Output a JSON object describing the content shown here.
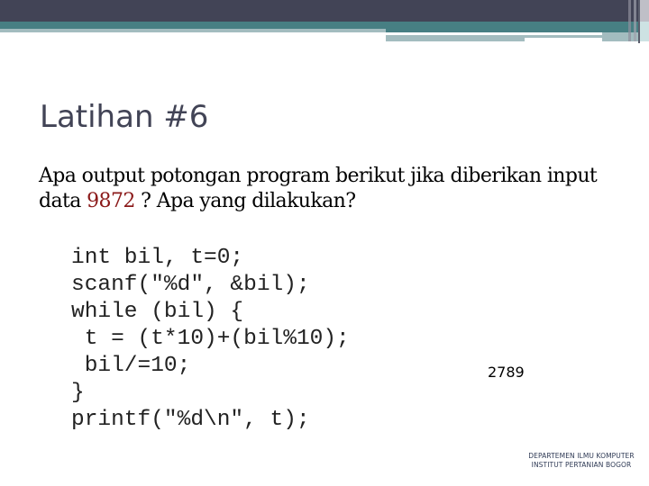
{
  "slide": {
    "title": "Latihan #6",
    "question": {
      "part1": "Apa output potongan program berikut jika diberikan input data ",
      "highlight": "9872",
      "part2": " ? Apa yang dilakukan?"
    },
    "code_lines": [
      "int bil, t=0;",
      "scanf(\"%d\", &bil);",
      "while (bil) {",
      " t = (t*10)+(bil%10);",
      " bil/=10;",
      "}",
      "printf(\"%d\\n\", t);"
    ],
    "answer": "2789",
    "footer": {
      "line1": "DEPARTEMEN ILMU KOMPUTER",
      "line2": "INSTITUT PERTANIAN BOGOR"
    }
  },
  "colors": {
    "header_dark": "#424456",
    "header_teal": "#477f83",
    "header_light": "#a3bcbf",
    "highlight": "#8b1a1a"
  }
}
